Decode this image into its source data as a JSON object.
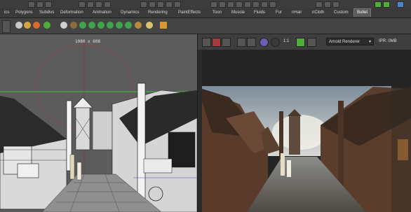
{
  "shelf_tabs": [
    "ics",
    "Polygons",
    "Subdivs",
    "Deformation",
    "Animation",
    "Dynamics",
    "Rendering",
    "PaintEffects",
    "Toon",
    "Muscle",
    "Fluids",
    "Fur",
    "nHair",
    "nCloth",
    "Custom",
    "Bullet"
  ],
  "active_tab": "Bullet",
  "viewport": {
    "resolution_label": "1080 x 608"
  },
  "render_view": {
    "zoom_label": "1:1",
    "renderer": "Arnold Renderer",
    "ipr_label": "IPR: 0MB"
  }
}
